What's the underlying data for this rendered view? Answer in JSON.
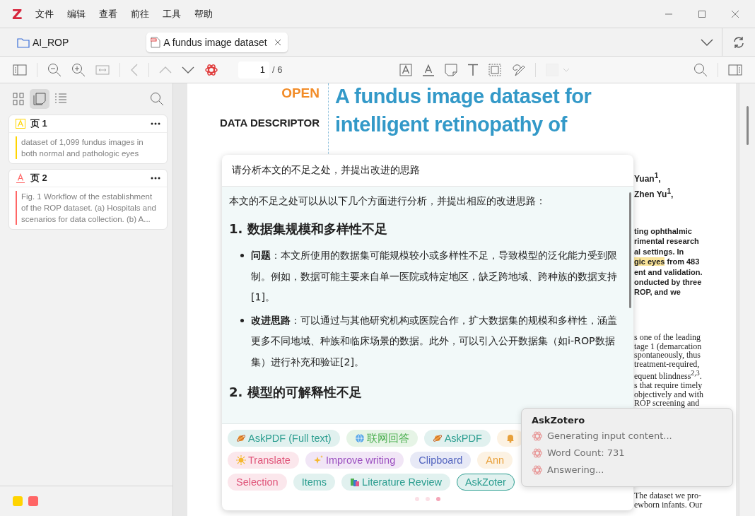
{
  "window": {
    "logo": "Z",
    "menu": [
      "文件",
      "编辑",
      "查看",
      "前往",
      "工具",
      "帮助"
    ]
  },
  "tabs": [
    {
      "label": "AI_ROP",
      "kind": "library",
      "selected": false
    },
    {
      "label": "A fundus image dataset",
      "kind": "pdf",
      "selected": true
    }
  ],
  "toolbar": {
    "page_input": "1",
    "page_total": "/ 6"
  },
  "sidebar": {
    "views": [
      {
        "kind": "thumbnails",
        "selected": false
      },
      {
        "kind": "annotations",
        "selected": true
      },
      {
        "kind": "outline",
        "selected": false
      }
    ],
    "annotations": [
      {
        "kind": "highlight",
        "color": "#ffd400",
        "page": "页 1",
        "text": "dataset of 1,099 fundus images in both normal and pathologic eyes"
      },
      {
        "kind": "underline",
        "color": "#ff6666",
        "page": "页 2",
        "text": "Fig. 1 Workflow of the establishment of the ROP dataset. (a) Hospitals and scenarios for data collection. (b) A..."
      }
    ],
    "colors": [
      {
        "color": "#ffd400"
      },
      {
        "color": "#ff6666"
      }
    ]
  },
  "pdf": {
    "badge": "OPEN",
    "section": "DATA DESCRIPTOR",
    "title": "A fundus image dataset for intelligent retinopathy of",
    "authors": [
      "Yuan$^{1}$,",
      "Zhen Yu$^{1}$,"
    ],
    "abstract": [
      {
        "text": "ting ophthalmic"
      },
      {
        "text": "rimental research"
      },
      {
        "text": "al settings. In"
      },
      {
        "highlight": "gic eyes",
        "text": " from 483"
      },
      {
        "text": "ent and validation."
      },
      {
        "text": "onducted by three"
      },
      {
        "text": "ROP, and we"
      }
    ],
    "body": [
      "s one of the leading",
      "tage 1 (demarcation",
      "spontaneously, thus",
      "treatment-required,",
      "equent blindness$^{2,3}$.",
      "s that require timely",
      "objectively and with",
      "ROP screening and"
    ],
    "body_bottom": [
      "The dataset we pro-",
      "ewborn infants. Our"
    ]
  },
  "popup": {
    "prompt": "请分析本文的不足之处，并提出改进的思路",
    "blocks": [
      {
        "kind": "p",
        "text": "本文的不足之处可以从以下几个方面进行分析，并提出相应的改进思路："
      },
      {
        "kind": "h",
        "text": "1. 数据集规模和多样性不足"
      },
      {
        "kind": "li",
        "text": "**问题**：本文所使用的数据集可能规模较小或多样性不足，导致模型的泛化能力受到限制。例如，数据可能主要来自单一医院或特定地区，缺乏跨地域、跨种族的数据支持[1]。"
      },
      {
        "kind": "li",
        "text": "**改进思路**：可以通过与其他研究机构或医院合作，扩大数据集的规模和多样性，涵盖更多不同地域、种族和临床场景的数据。此外，可以引入公开数据集（如i-ROP数据集）进行补充和验证[2]。"
      },
      {
        "kind": "h",
        "text": "2. 模型的可解释性不足"
      }
    ],
    "chip_rows": [
      [
        {
          "label": "AskPDF (Full text)",
          "color": "#2a9d8f",
          "selected": false
        },
        {
          "label": "联网回答",
          "color": "#4caf50",
          "selected": false
        },
        {
          "label": "AskPDF",
          "color": "#2a9d8f",
          "selected": false
        },
        {
          "color": "#e8a03a",
          "selected": false
        }
      ],
      [
        {
          "label": "Translate",
          "color": "#e0557a",
          "selected": false
        },
        {
          "label": "Improve writing",
          "color": "#9b4fc0",
          "selected": false
        },
        {
          "label": "Clipboard",
          "color": "#5566c0",
          "selected": false
        },
        {
          "label": "Ann",
          "color": "#e8a03a",
          "selected": false
        }
      ],
      [
        {
          "label": "Selection",
          "color": "#e0557a",
          "selected": false
        },
        {
          "label": "Items",
          "color": "#2a9d8f",
          "selected": false
        },
        {
          "label": "Literature Review",
          "color": "#2a9d8f",
          "selected": false
        },
        {
          "label": "AskZoter",
          "color": "#2a9d8f",
          "selected": true
        }
      ]
    ],
    "pages": [
      {
        "selected": false
      },
      {
        "selected": false
      },
      {
        "selected": true
      }
    ]
  },
  "toast": {
    "title": "AskZotero",
    "lines": [
      "Generating input content...",
      "Word Count: 731",
      "Answering..."
    ]
  }
}
